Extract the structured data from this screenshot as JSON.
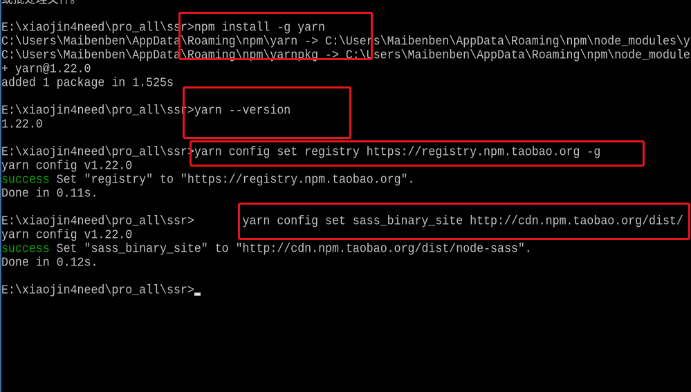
{
  "terminal": {
    "lines": [
      "或批处理文件。",
      "",
      "E:\\xiaojin4need\\pro_all\\ssr>npm install -g yarn",
      "C:\\Users\\Maibenben\\AppData\\Roaming\\npm\\yarn -> C:\\Users\\Maibenben\\AppData\\Roaming\\npm\\node_modules\\y",
      "C:\\Users\\Maibenben\\AppData\\Roaming\\npm\\yarnpkg -> C:\\Users\\Maibenben\\AppData\\Roaming\\npm\\node_module",
      "+ yarn@1.22.0",
      "added 1 package in 1.525s",
      "",
      "E:\\xiaojin4need\\pro_all\\ssr>yarn --version",
      "1.22.0",
      "",
      "E:\\xiaojin4need\\pro_all\\ssr>yarn config set registry https://registry.npm.taobao.org -g",
      "yarn config v1.22.0",
      "",
      "Done in 0.11s.",
      "",
      "E:\\xiaojin4need\\pro_all\\ssr>       yarn config set sass_binary_site http://cdn.npm.taobao.org/dist/",
      "yarn config v1.22.0",
      "",
      "Done in 0.12s.",
      "",
      "E:\\xiaojin4need\\pro_all\\ssr>"
    ],
    "success_lines": [
      {
        "status": "success",
        "text": " Set \"registry\" to \"https://registry.npm.taobao.org\"."
      },
      {
        "status": "success",
        "text": " Set \"sass_binary_site\" to \"http://cdn.npm.taobao.org/dist/node-sass\"."
      }
    ]
  },
  "colors": {
    "background": "#000000",
    "text": "#c0c0c0",
    "success": "#13a10e",
    "highlight_box": "#e8141c"
  }
}
